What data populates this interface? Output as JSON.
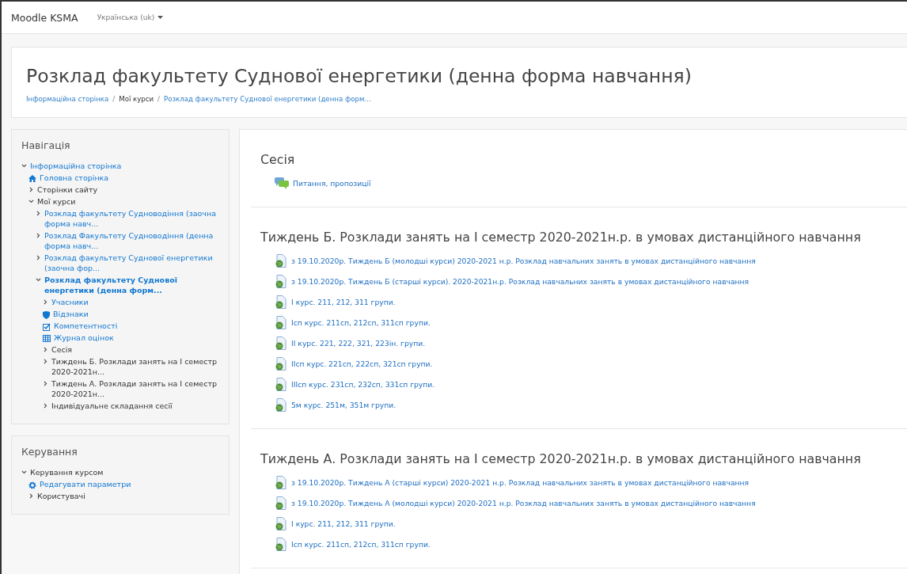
{
  "navbar": {
    "brand": "Moodle KSMA",
    "language": "Українська (uk)"
  },
  "header": {
    "title": "Розклад факультету Суднової енергетики (денна форма навчання)",
    "separator": "/",
    "breadcrumbs": [
      {
        "label": "Інформаційна сторінка",
        "link": true
      },
      {
        "label": "Мої курси",
        "link": false
      },
      {
        "label": "Розклад факультету Суднової енергетики (денна форм...",
        "link": true
      }
    ]
  },
  "blocks": [
    {
      "title": "Навігація",
      "items": [
        {
          "label": "Інформаційна сторінка",
          "kind": "branch",
          "expanded": true,
          "link": true,
          "selected": false,
          "children": [
            {
              "label": "Головна сторінка",
              "kind": "home",
              "link": true,
              "selected": false
            },
            {
              "label": "Сторінки сайту",
              "kind": "branch",
              "expanded": false,
              "link": false,
              "selected": false
            },
            {
              "label": "Мої курси",
              "kind": "branch",
              "expanded": true,
              "link": false,
              "selected": false,
              "children": [
                {
                  "label": "Розклад факультету Судноводіння (заочна форма навч...",
                  "kind": "branch",
                  "expanded": false,
                  "link": true,
                  "selected": false
                },
                {
                  "label": "Розклад Факультету Судноводіння (денна форма навч...",
                  "kind": "branch",
                  "expanded": false,
                  "link": true,
                  "selected": false
                },
                {
                  "label": "Розклад факультету Суднової енергетики (заочна фор...",
                  "kind": "branch",
                  "expanded": false,
                  "link": true,
                  "selected": false
                },
                {
                  "label": "Розклад факультету Суднової енергетики (денна форм...",
                  "kind": "branch",
                  "expanded": true,
                  "link": true,
                  "selected": true,
                  "children": [
                    {
                      "label": "Учасники",
                      "kind": "branch",
                      "expanded": false,
                      "link": true,
                      "selected": false
                    },
                    {
                      "label": "Відзнаки",
                      "kind": "badge",
                      "link": true,
                      "selected": false
                    },
                    {
                      "label": "Компетентності",
                      "kind": "competency",
                      "link": true,
                      "selected": false
                    },
                    {
                      "label": "Журнал оцінок",
                      "kind": "grades",
                      "link": true,
                      "selected": false
                    },
                    {
                      "label": "Сесія",
                      "kind": "branch",
                      "expanded": false,
                      "link": false,
                      "selected": false
                    },
                    {
                      "label": "Тиждень Б. Розклади занять на I семестр 2020-2021н...",
                      "kind": "branch",
                      "expanded": false,
                      "link": false,
                      "selected": false
                    },
                    {
                      "label": "Тиждень А. Розклади занять на I семестр 2020-2021н...",
                      "kind": "branch",
                      "expanded": false,
                      "link": false,
                      "selected": false
                    },
                    {
                      "label": "Індивідуальне складання сесії",
                      "kind": "branch",
                      "expanded": false,
                      "link": false,
                      "selected": false
                    }
                  ]
                }
              ]
            }
          ]
        }
      ]
    },
    {
      "title": "Керування",
      "items": [
        {
          "label": "Керування курсом",
          "kind": "branch",
          "expanded": true,
          "link": false,
          "selected": false,
          "children": [
            {
              "label": "Редагувати параметри",
              "kind": "settings",
              "link": true,
              "selected": false
            },
            {
              "label": "Користувачі",
              "kind": "branch",
              "expanded": false,
              "link": false,
              "selected": false
            }
          ]
        }
      ]
    }
  ],
  "sections": [
    {
      "title": "Сесія",
      "activities": [
        {
          "kind": "forum",
          "label": "Питання, пропозиції"
        }
      ]
    },
    {
      "title": "Тиждень Б. Розклади занять на I семестр 2020-2021н.р. в умовах дистанційного навчання",
      "activities": [
        {
          "kind": "url",
          "label": "з 19.10.2020р. Тиждень Б (молодші курси) 2020-2021 н.р. Розклад навчальних занять в умовах дистанційного навчання"
        },
        {
          "kind": "url",
          "label": "з 19.10.2020р. Тиждень Б (старші курси). 2020-2021н.р. Розклад навчальних занять в умовах дистанційного навчання"
        },
        {
          "kind": "url",
          "label": "I курс. 211, 212, 311 групи."
        },
        {
          "kind": "url",
          "label": "Iсп курс. 211сп, 212сп, 311сп групи."
        },
        {
          "kind": "url",
          "label": "II курс. 221, 222, 321, 223ін. групи."
        },
        {
          "kind": "url",
          "label": "IIсп курс. 221сп, 222сп, 321сп групи."
        },
        {
          "kind": "url",
          "label": "IIIсп курс. 231сп, 232сп, 331сп групи."
        },
        {
          "kind": "url",
          "label": "5м курс. 251м, 351м групи."
        }
      ]
    },
    {
      "title": "Тиждень А. Розклади занять на I семестр 2020-2021н.р. в умовах дистанційного навчання",
      "activities": [
        {
          "kind": "url",
          "label": "з 19.10.2020р. Тиждень А (старші курси) 2020-2021 н.р. Розклад навчальних занять в умовах дистанційного навчання"
        },
        {
          "kind": "url",
          "label": "з 19.10.2020р. Тиждень А (молодші курси) 2020-2021 н.р. Розклад навчальних занять в умовах дистанційного навчання"
        },
        {
          "kind": "url",
          "label": "I курс. 211, 212, 311 групи."
        },
        {
          "kind": "url",
          "label": "Iсп курс. 211сп, 212сп, 311сп групи."
        }
      ]
    }
  ]
}
